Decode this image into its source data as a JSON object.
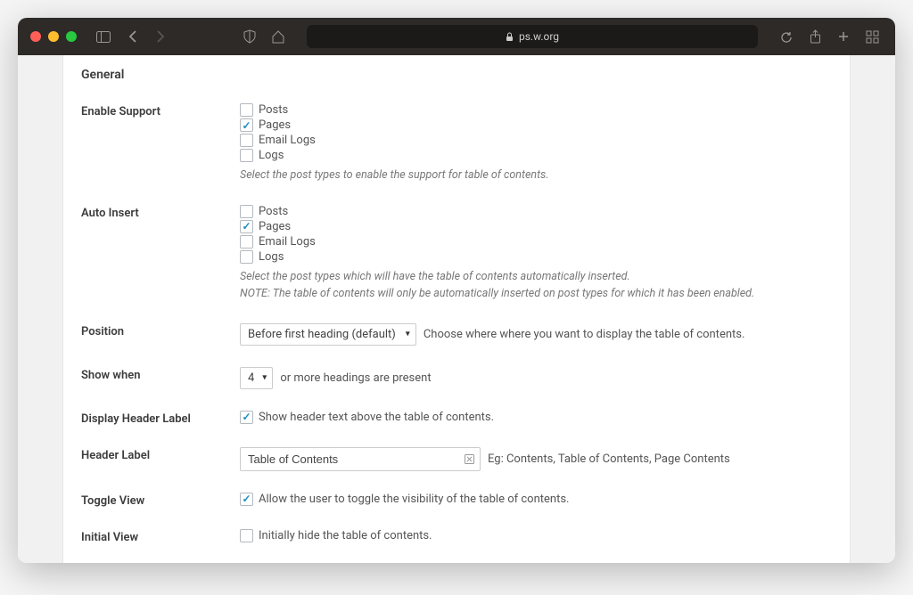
{
  "browser": {
    "url": "ps.w.org"
  },
  "section": {
    "title": "General"
  },
  "enableSupport": {
    "label": "Enable Support",
    "options": {
      "posts": "Posts",
      "pages": "Pages",
      "emailLogs": "Email Logs",
      "logs": "Logs"
    },
    "hint": "Select the post types to enable the support for table of contents."
  },
  "autoInsert": {
    "label": "Auto Insert",
    "options": {
      "posts": "Posts",
      "pages": "Pages",
      "emailLogs": "Email Logs",
      "logs": "Logs"
    },
    "hint1": "Select the post types which will have the table of contents automatically inserted.",
    "hint2": "NOTE: The table of contents will only be automatically inserted on post types for which it has been enabled."
  },
  "position": {
    "label": "Position",
    "value": "Before first heading (default)",
    "after": "Choose where where you want to display the table of contents."
  },
  "showWhen": {
    "label": "Show when",
    "value": "4",
    "after": "or more headings are present"
  },
  "displayHeader": {
    "label": "Display Header Label",
    "text": "Show header text above the table of contents."
  },
  "headerLabel": {
    "label": "Header Label",
    "value": "Table of Contents",
    "after": "Eg: Contents, Table of Contents, Page Contents"
  },
  "toggleView": {
    "label": "Toggle View",
    "text": "Allow the user to toggle the visibility of the table of contents."
  },
  "initialView": {
    "label": "Initial View",
    "text": "Initially hide the table of contents."
  }
}
